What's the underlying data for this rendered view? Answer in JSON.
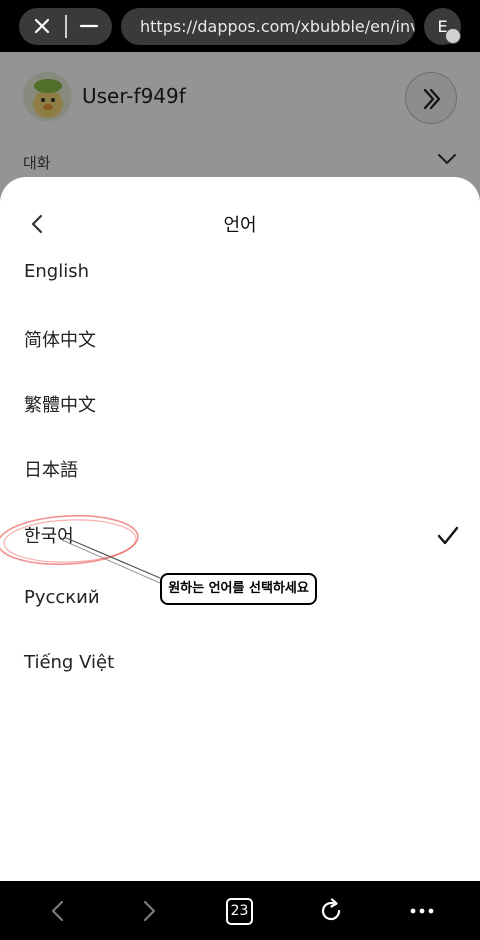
{
  "browser": {
    "url": "https://dappos.com/xbubble/en/inv...",
    "extension_label": "E",
    "tab_count": "23"
  },
  "background_page": {
    "username": "User-f949f",
    "section_label": "대화"
  },
  "language_sheet": {
    "title": "언어",
    "selected": "한국어",
    "languages": [
      "English",
      "简体中文",
      "繁體中文",
      "日本語",
      "한국어",
      "Русский",
      "Tiếng Việt"
    ]
  },
  "annotation": {
    "text": "원하는 언어를 선택하세요",
    "color": "#e53935"
  },
  "icons": [
    "close-icon",
    "minimize-icon",
    "chevron-right-icon",
    "chevron-down-icon",
    "chevron-left-icon",
    "check-icon",
    "back-arrow-icon",
    "forward-arrow-icon",
    "refresh-icon",
    "more-icon"
  ]
}
